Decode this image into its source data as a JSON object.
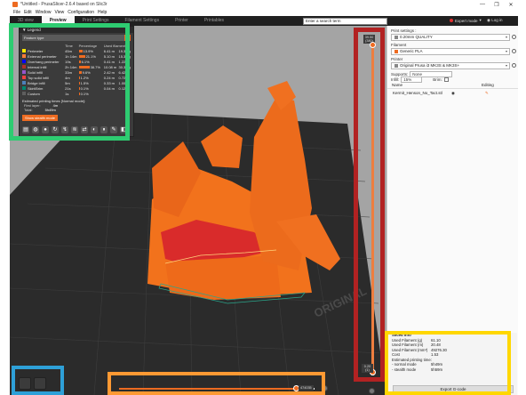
{
  "window": {
    "title": "*Untitled - PrusaSlicer-2.6.4 based on Slic3r",
    "controls": [
      "—",
      "❐",
      "✕"
    ]
  },
  "menu": [
    "File",
    "Edit",
    "Window",
    "View",
    "Configuration",
    "Help"
  ],
  "tabs": [
    {
      "label": "3D view",
      "active": false
    },
    {
      "label": "Preview",
      "active": true
    },
    {
      "label": "Print Settings",
      "active": false
    },
    {
      "label": "Filament Settings",
      "active": false
    },
    {
      "label": "Printer",
      "active": false
    },
    {
      "label": "Printables",
      "active": false
    }
  ],
  "search": {
    "placeholder": "Enter a search term"
  },
  "mode": {
    "label": "Expert mode",
    "color": "#e03030"
  },
  "login": {
    "label": "Log in"
  },
  "legend": {
    "title": "Legend",
    "combo": "Feature type",
    "columns": [
      "",
      "Time",
      "Percentage",
      "Used filament"
    ],
    "rows": [
      {
        "name": "Perimeter",
        "time": "45m",
        "percent": "13.9%",
        "percent_value": 13.9,
        "length": "6.41 m",
        "weight": "19.34 g",
        "color": "#ffe600"
      },
      {
        "name": "External perimeter",
        "time": "1h 14m",
        "percent": "21.1%",
        "percent_value": 21.1,
        "length": "5.10 m",
        "weight": "15.36 g",
        "color": "#ff7d38"
      },
      {
        "name": "Overhang perimeter",
        "time": "19s",
        "percent": "6.1%",
        "percent_value": 6.1,
        "length": "0.41 m",
        "weight": "1.22 g",
        "color": "#0000ff"
      },
      {
        "name": "Internal infill",
        "time": "2h 14m",
        "percent": "38.7%",
        "percent_value": 38.7,
        "length": "10.08 m",
        "weight": "30.36 g",
        "color": "#b03029"
      },
      {
        "name": "Solid infill",
        "time": "33m",
        "percent": "9.6%",
        "percent_value": 9.6,
        "length": "2.42 m",
        "weight": "6.42 g",
        "color": "#9654cc"
      },
      {
        "name": "Top solid infill",
        "time": "4m",
        "percent": "1.2%",
        "percent_value": 1.2,
        "length": "0.24 m",
        "weight": "0.72 g",
        "color": "#f04040"
      },
      {
        "name": "Bridge infill",
        "time": "5m",
        "percent": "1.5%",
        "percent_value": 1.5,
        "length": "0.33 m",
        "weight": "1.00 g",
        "color": "#4d80ba"
      },
      {
        "name": "Skirt/Brim",
        "time": "21s",
        "percent": "0.1%",
        "percent_value": 0.1,
        "length": "0.04 m",
        "weight": "0.12 g",
        "color": "#00876e"
      },
      {
        "name": "Custom",
        "time": "1s",
        "percent": "0.1%",
        "percent_value": 0.1,
        "length": "",
        "weight": "",
        "color": "#5e5e5e"
      }
    ],
    "estimated_label": "Estimated printing times [Normal mode]:",
    "modes": [
      {
        "name": "First layer:",
        "value": "4m"
      },
      {
        "name": "Total:",
        "value": "5h49m"
      }
    ],
    "show_button": "Show stealth mode",
    "tool_icons": [
      "perimeter-icon",
      "shells-icon",
      "seams-icon",
      "retractions-icon",
      "travel-icon",
      "wipe-icon",
      "tool-changes-icon",
      "color-changes-icon",
      "pause-icon",
      "custom-gcode-icon",
      "legend-icon"
    ]
  },
  "vertical_slider": {
    "top_label": "39.50\n(380)",
    "bottom_label": "0.20\n(1)",
    "level_fraction": 1.0
  },
  "horizontal_slider": {
    "value": "474035",
    "level_fraction": 0.95
  },
  "bed_label": "ORIGINAL",
  "panel": {
    "print_settings_label": "Print settings :",
    "print_settings_value": "0.20mm QUALITY",
    "filament_label": "Filament",
    "filament_value": "Generic PLA",
    "filament_color": "#ed6b21",
    "printer_label": "Printer",
    "printer_value": "Original Prusa i3 MK3S & MK3S+",
    "supports_label": "Supports:",
    "supports_value": "None",
    "infill_label": "Infill:",
    "infill_value": "15%",
    "brim_label": "Brim:",
    "col_name": "Name",
    "col_editing": "Editing",
    "object_name": "Kermit_Henson_No_Tact.stl"
  },
  "sliced_info": {
    "title": "Sliced Info",
    "rows": [
      {
        "label": "Used Filament (g)",
        "value": "61.10"
      },
      {
        "label": "Used Filament (m)",
        "value": "20.48"
      },
      {
        "label": "Used Filament (mm³)",
        "value": "49276.30"
      },
      {
        "label": "Cost",
        "value": "1.53"
      },
      {
        "label": "Estimated printing time:",
        "value": ""
      },
      {
        "label": " - normal mode",
        "value": "5h49m"
      },
      {
        "label": " - stealth mode",
        "value": "5h59m"
      }
    ],
    "export_button": "Export G-code"
  },
  "highlights": {
    "legend_color": "#2ecc71",
    "slider_v_color": "#b22222",
    "slider_h_color": "#ff9933",
    "view_color": "#2ea0d8",
    "sliced_color": "#ffd700"
  }
}
